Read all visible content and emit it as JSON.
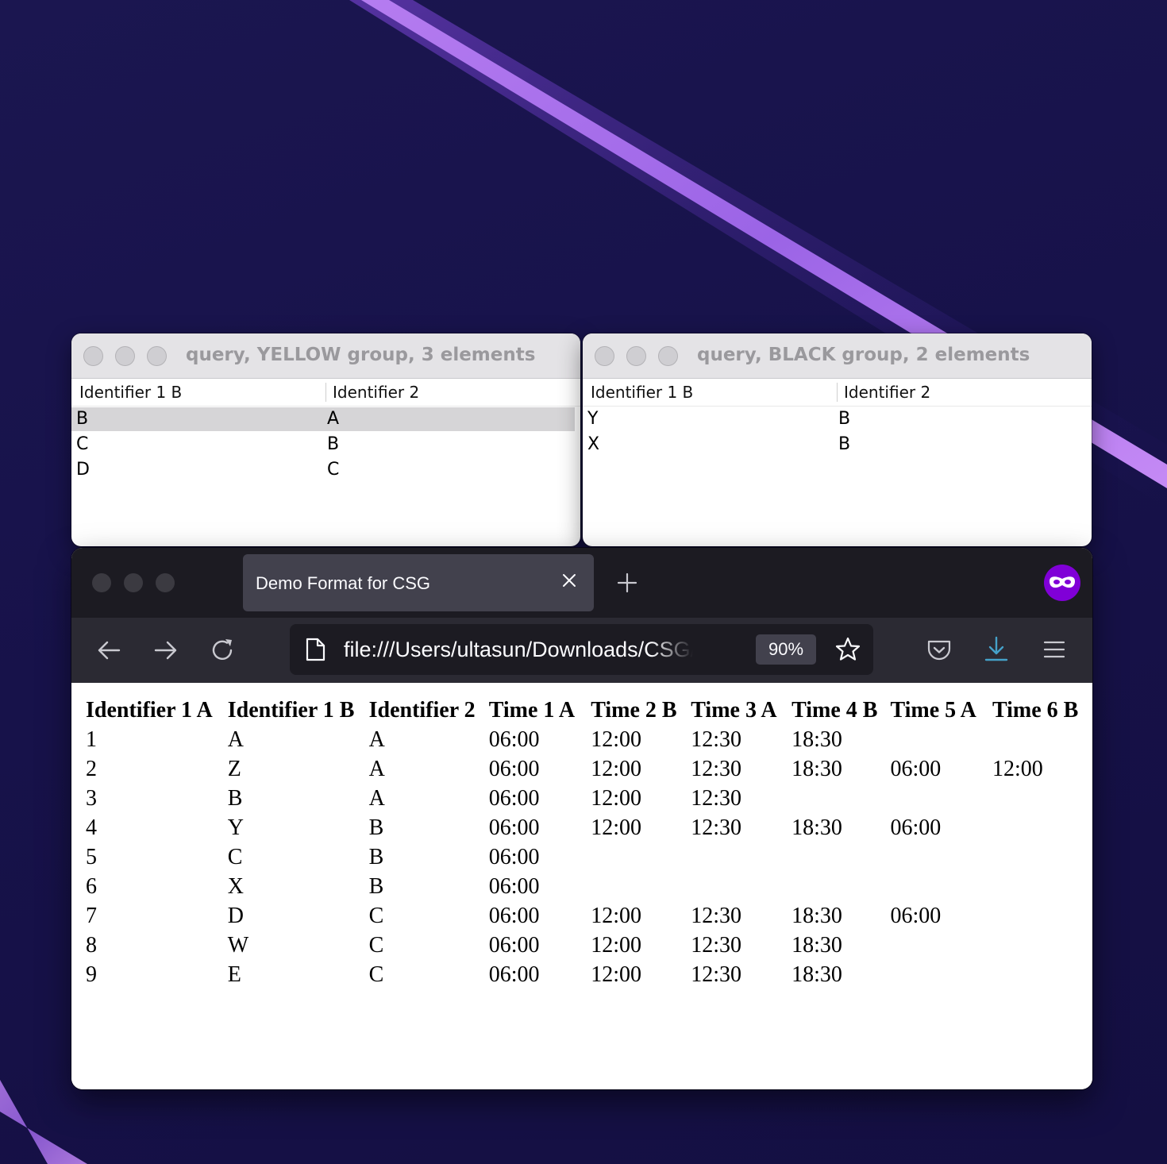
{
  "query_windows": [
    {
      "title": "query, YELLOW group, 3 elements",
      "headers": [
        "Identifier 1 B",
        "Identifier 2"
      ],
      "rows": [
        [
          "B",
          "A"
        ],
        [
          "C",
          "B"
        ],
        [
          "D",
          "C"
        ]
      ],
      "selected_row": 1
    },
    {
      "title": "query, BLACK group, 2 elements",
      "headers": [
        "Identifier 1 B",
        "Identifier 2"
      ],
      "rows": [
        [
          "Y",
          "B"
        ],
        [
          "X",
          "B"
        ]
      ]
    }
  ],
  "browser": {
    "tab_title": "Demo Format for CSG",
    "url": "file:///Users/ultasun/Downloads/CSG/demo",
    "zoom": "90%",
    "icons": [
      "back-arrow-icon",
      "forward-arrow-icon",
      "reload-icon",
      "page-icon",
      "star-icon",
      "pocket-icon",
      "download-icon",
      "hamburger-menu-icon",
      "private-browsing-icon",
      "close-icon",
      "plus-icon"
    ],
    "colors": {
      "tab_strip": "#1c1b22",
      "toolbar": "#2b2a33",
      "private_badge": "#8000d7",
      "download_accent": "#45a1c9"
    }
  },
  "table": {
    "headers": [
      "Identifier 1 A",
      "Identifier 1 B",
      "Identifier 2",
      "Time 1 A",
      "Time 2 B",
      "Time 3 A",
      "Time 4 B",
      "Time 5 A",
      "Time 6 B"
    ],
    "rows": [
      [
        "1",
        "A",
        "A",
        "06:00",
        "12:00",
        "12:30",
        "18:30",
        "",
        ""
      ],
      [
        "2",
        "Z",
        "A",
        "06:00",
        "12:00",
        "12:30",
        "18:30",
        "06:00",
        "12:00"
      ],
      [
        "3",
        "B",
        "A",
        "06:00",
        "12:00",
        "12:30",
        "",
        "",
        ""
      ],
      [
        "4",
        "Y",
        "B",
        "06:00",
        "12:00",
        "12:30",
        "18:30",
        "06:00",
        ""
      ],
      [
        "5",
        "C",
        "B",
        "06:00",
        "",
        "",
        "",
        "",
        ""
      ],
      [
        "6",
        "X",
        "B",
        "06:00",
        "",
        "",
        "",
        "",
        ""
      ],
      [
        "7",
        "D",
        "C",
        "06:00",
        "12:00",
        "12:30",
        "18:30",
        "06:00",
        ""
      ],
      [
        "8",
        "W",
        "C",
        "06:00",
        "12:00",
        "12:30",
        "18:30",
        "",
        ""
      ],
      [
        "9",
        "E",
        "C",
        "06:00",
        "12:00",
        "12:30",
        "18:30",
        "",
        ""
      ]
    ]
  }
}
